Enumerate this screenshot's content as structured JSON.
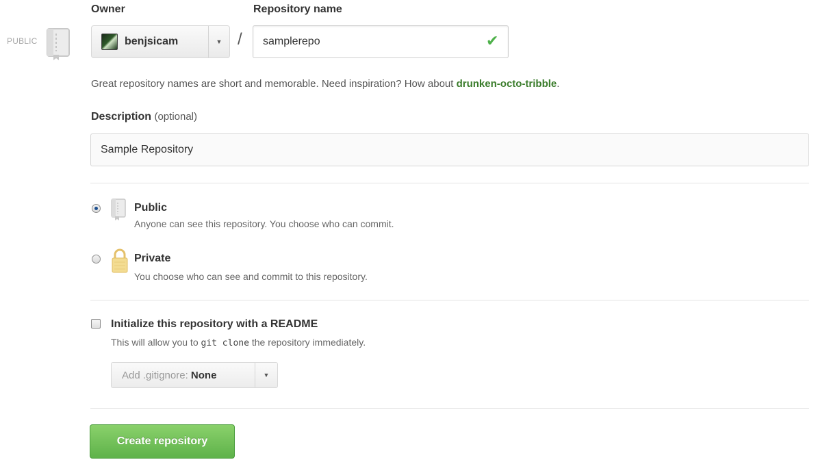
{
  "sidebar": {
    "visibility_label": "PUBLIC",
    "icon": "repo-book-icon"
  },
  "owner": {
    "label": "Owner",
    "selected": "benjsicam",
    "icon": "avatar"
  },
  "separator": "/",
  "repository": {
    "label": "Repository name",
    "value": "samplerepo",
    "status_icon": "check-icon"
  },
  "hint": {
    "text": "Great repository names are short and memorable. Need inspiration? How about ",
    "suggestion": "drunken-octo-tribble",
    "suffix": "."
  },
  "description": {
    "label": "Description",
    "optional": "(optional)",
    "value": "Sample Repository"
  },
  "visibility": {
    "options": [
      {
        "title": "Public",
        "description": "Anyone can see this repository. You choose who can commit.",
        "selected": true,
        "icon": "repo-book-icon"
      },
      {
        "title": "Private",
        "description": "You choose who can see and commit to this repository.",
        "selected": false,
        "icon": "lock-icon"
      }
    ]
  },
  "readme": {
    "title": "Initialize this repository with a README",
    "desc_prefix": "This will allow you to",
    "desc_code": "git clone",
    "desc_suffix": "the repository immediately.",
    "checked": false
  },
  "gitignore": {
    "label": "Add .gitignore:",
    "value": "None"
  },
  "submit": {
    "label": "Create repository"
  },
  "colors": {
    "accent_green": "#5eb24a",
    "link_green": "#3a7c2b",
    "check_green": "#4eb14a"
  }
}
